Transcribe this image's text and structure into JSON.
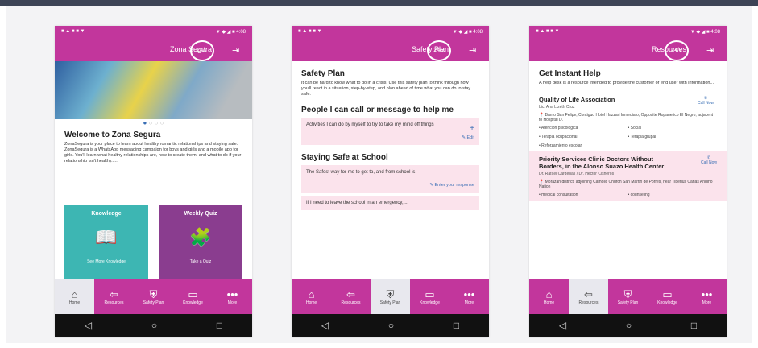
{
  "status": {
    "left": "■ ▲ ■ ■ ▼",
    "right": "▼ ◆ ◢ ■ 4:08"
  },
  "badge_label": "24/7",
  "nav": [
    {
      "label": "Home"
    },
    {
      "label": "Resources"
    },
    {
      "label": "Safety Plan"
    },
    {
      "label": "Knowledge"
    },
    {
      "label": "More"
    }
  ],
  "screen1": {
    "title": "Zona Segura",
    "welcome_title": "Welcome to Zona Segura",
    "welcome_body": "ZonaSegura is your place to learn about healthy romantic relationships and staying safe. ZonaSegura is a WhatsApp messaging campaign for boys and girls and a mobile app for girls. You'll learn what healthy relationships are, how to create them, and what to do if your relationship isn't healthy.....",
    "tile_knowledge": {
      "title": "Knowledge",
      "sub": "See More Knowledge"
    },
    "tile_quiz": {
      "title": "Weekly Quiz",
      "sub": "Take a Quiz"
    }
  },
  "screen2": {
    "title": "Safety Plan",
    "h1": "Safety Plan",
    "intro": "It can be hard to know what to do in a crisis. Use this safety plan to think through how you'll react in a situation, step-by-step, and plan ahead of time what you can do to stay safe.",
    "h2": "People I can call or message to help me",
    "card1": "Activities I can do by myself to try to take my mind off things",
    "edit_label": "Edit",
    "h3": "Staying Safe at School",
    "card2": "The Safest way for me to get to, and from school is",
    "enter_label": "Enter your response",
    "card3": "If I need to leave the school in an emergency, ..."
  },
  "screen3": {
    "title": "Resources",
    "h1": "Get Instant Help",
    "intro": "A help desk is a resource intended to provide the customer or end user with information...",
    "org1_title": "Quality of Life Association",
    "org1_sub": "Lic. Ana Lizeth Cruz",
    "org1_addr": "Barrio San Felipe, Contiguo Hotel Hazzari Inmediato, Opposite Ropanerico El Negro, adjacent to Hospital D.",
    "org1_services": [
      "Atencion psicologica",
      "Social",
      "Terapia ocupacional",
      "Terapia grupal",
      "Reforzamiento escolar"
    ],
    "call_label": "Call Now",
    "org2_title": "Priority Services Clinic Doctors Without Borders, in the Alonso Suazo Health Center",
    "org2_sub": "Dr. Rafael Cardenas / Dr. Hector Cisneros",
    "org2_addr": "Morazán district, adjoining Catholic Church San Martin de Porres, near Tiberius Carias Andino Nation",
    "org2_services": [
      "medical consultation",
      "counseling"
    ]
  }
}
